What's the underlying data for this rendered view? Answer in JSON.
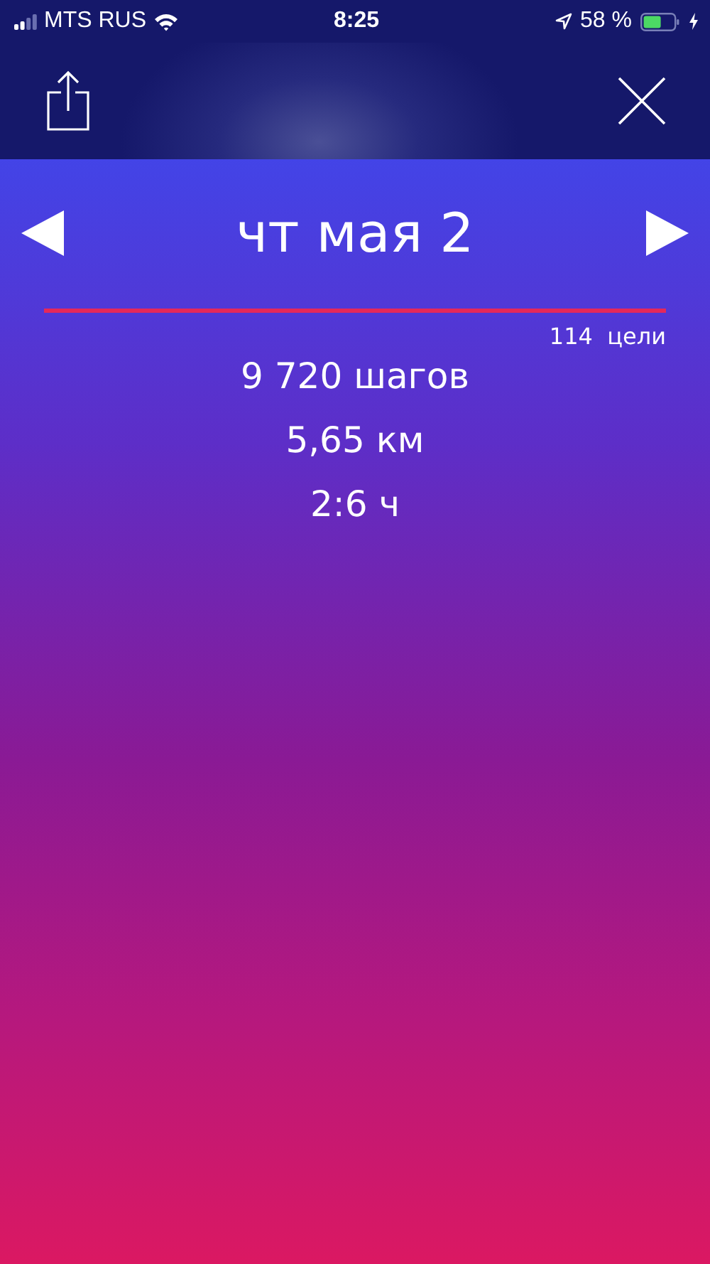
{
  "status_bar": {
    "carrier": "MTS RUS",
    "time": "8:25",
    "battery": "58 %"
  },
  "day": {
    "date": "чт мая 2"
  },
  "goal": {
    "label": "114  цели"
  },
  "stats": [
    "9 720 шагов",
    "5,65 км",
    "2:6 ч"
  ]
}
